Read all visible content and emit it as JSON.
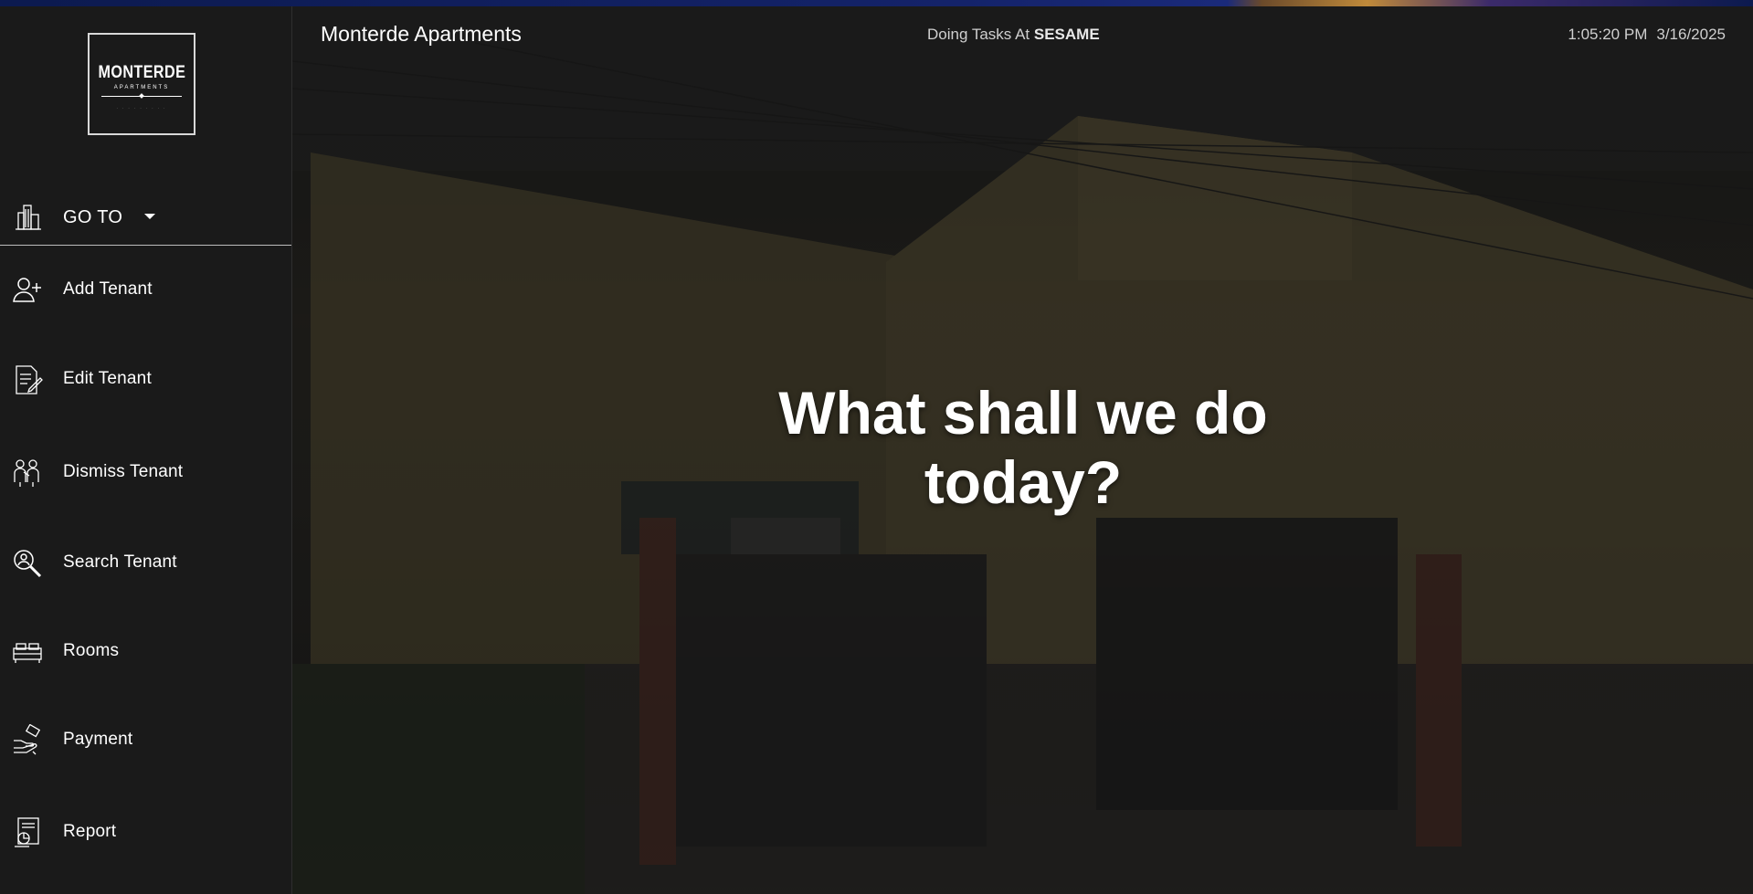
{
  "sidebar": {
    "logo": {
      "title": "MONTERDE",
      "subtitle": "APARTMENTS"
    },
    "goto_label": "GO TO",
    "items": [
      {
        "label": "Add Tenant",
        "icon": "add-user-icon"
      },
      {
        "label": "Edit Tenant",
        "icon": "edit-document-icon"
      },
      {
        "label": "Dismiss Tenant",
        "icon": "dismiss-people-icon"
      },
      {
        "label": "Search Tenant",
        "icon": "search-user-icon"
      },
      {
        "label": "Rooms",
        "icon": "rooms-icon"
      },
      {
        "label": "Payment",
        "icon": "payment-icon"
      },
      {
        "label": "Report",
        "icon": "report-icon"
      }
    ]
  },
  "header": {
    "title": "Monterde Apartments",
    "doing_prefix": "Doing Tasks At",
    "doing_user": "SESAME",
    "time": "1:05:20 PM",
    "date": "3/16/2025"
  },
  "hero": {
    "line1": "What shall we do",
    "line2": "today?"
  },
  "colors": {
    "sidebar_bg": "#1a1a1a",
    "text": "#ffffff",
    "subtle_text": "#cfcfcf"
  }
}
